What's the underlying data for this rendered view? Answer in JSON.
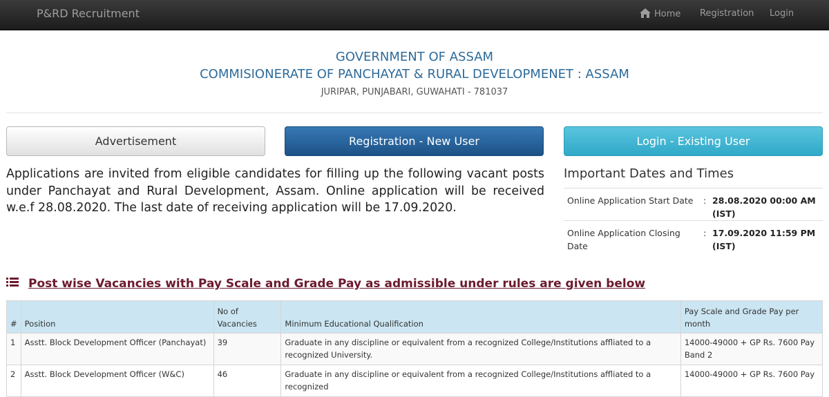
{
  "navbar": {
    "brand": "P&RD Recruitment",
    "items": [
      {
        "label": "Home",
        "icon": "home-icon"
      },
      {
        "label": "Registration"
      },
      {
        "label": "Login"
      }
    ]
  },
  "header": {
    "line1": "GOVERNMENT OF ASSAM",
    "line2": "COMMISIONERATE OF PANCHAYAT & RURAL DEVELOPMENET : ASSAM",
    "address": "JURIPAR, PUNJABARI, GUWAHATI - 781037"
  },
  "buttons": {
    "advertisement": "Advertisement",
    "registration": "Registration - New User",
    "login": "Login - Existing User"
  },
  "intro": "Applications are invited from eligible candidates for filling up the following vacant posts under Panchayat and Rural Development, Assam. Online application will be received w.e.f 28.08.2020. The last date of receiving application will be 17.09.2020.",
  "important_dates": {
    "title": "Important Dates and Times",
    "rows": [
      {
        "label": "Online Application Start Date",
        "separator": ":",
        "value": "28.08.2020 00:00 AM (IST)"
      },
      {
        "label": "Online Application Closing Date",
        "separator": ":",
        "value": "17.09.2020 11:59 PM (IST)"
      }
    ]
  },
  "section": {
    "title": "Post wise Vacancies with Pay Scale and Grade Pay as admissible under rules are given below",
    "icon": "list-icon"
  },
  "table": {
    "headers": [
      "#",
      "Position",
      "No of Vacancies",
      "Minimum Educational Qualification",
      "Pay Scale and Grade Pay per month"
    ],
    "rows": [
      [
        "1",
        "Asstt. Block Development Officer (Panchayat)",
        "39",
        "Graduate in any discipline or equivalent from a recognized College/Institutions affliated to a recognized University.",
        "14000-49000 + GP Rs. 7600 Pay Band 2"
      ],
      [
        "2",
        "Asstt. Block Development Officer (W&C)",
        "46",
        "Graduate in any discipline or equivalent from a recognized College/Institutions affliated to a recognized",
        "14000-49000 + GP Rs. 7600 Pay"
      ]
    ]
  },
  "colors": {
    "navbar_bg": "#222222",
    "header_text": "#2d6b9a",
    "primary_button": "#2a6aa5",
    "info_button": "#46b8da",
    "section_title": "#6b1a2e",
    "table_header_bg": "#cbe6f2"
  }
}
